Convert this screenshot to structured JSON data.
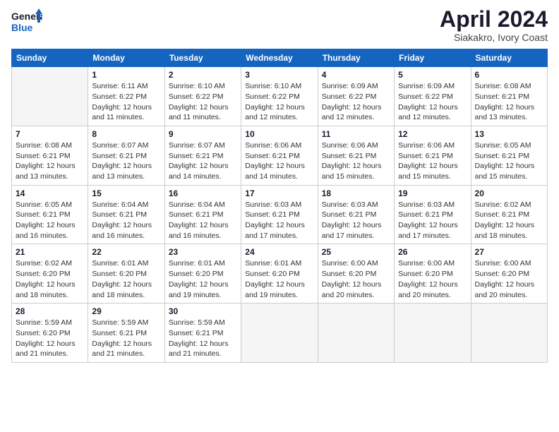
{
  "logo": {
    "line1": "General",
    "line2": "Blue"
  },
  "header": {
    "title": "April 2024",
    "location": "Siakakro, Ivory Coast"
  },
  "days_of_week": [
    "Sunday",
    "Monday",
    "Tuesday",
    "Wednesday",
    "Thursday",
    "Friday",
    "Saturday"
  ],
  "weeks": [
    [
      {
        "num": "",
        "sunrise": "",
        "sunset": "",
        "daylight": "",
        "empty": true
      },
      {
        "num": "1",
        "sunrise": "6:11 AM",
        "sunset": "6:22 PM",
        "daylight": "12 hours and 11 minutes."
      },
      {
        "num": "2",
        "sunrise": "6:10 AM",
        "sunset": "6:22 PM",
        "daylight": "12 hours and 11 minutes."
      },
      {
        "num": "3",
        "sunrise": "6:10 AM",
        "sunset": "6:22 PM",
        "daylight": "12 hours and 12 minutes."
      },
      {
        "num": "4",
        "sunrise": "6:09 AM",
        "sunset": "6:22 PM",
        "daylight": "12 hours and 12 minutes."
      },
      {
        "num": "5",
        "sunrise": "6:09 AM",
        "sunset": "6:22 PM",
        "daylight": "12 hours and 12 minutes."
      },
      {
        "num": "6",
        "sunrise": "6:08 AM",
        "sunset": "6:21 PM",
        "daylight": "12 hours and 13 minutes."
      }
    ],
    [
      {
        "num": "7",
        "sunrise": "6:08 AM",
        "sunset": "6:21 PM",
        "daylight": "12 hours and 13 minutes."
      },
      {
        "num": "8",
        "sunrise": "6:07 AM",
        "sunset": "6:21 PM",
        "daylight": "12 hours and 13 minutes."
      },
      {
        "num": "9",
        "sunrise": "6:07 AM",
        "sunset": "6:21 PM",
        "daylight": "12 hours and 14 minutes."
      },
      {
        "num": "10",
        "sunrise": "6:06 AM",
        "sunset": "6:21 PM",
        "daylight": "12 hours and 14 minutes."
      },
      {
        "num": "11",
        "sunrise": "6:06 AM",
        "sunset": "6:21 PM",
        "daylight": "12 hours and 15 minutes."
      },
      {
        "num": "12",
        "sunrise": "6:06 AM",
        "sunset": "6:21 PM",
        "daylight": "12 hours and 15 minutes."
      },
      {
        "num": "13",
        "sunrise": "6:05 AM",
        "sunset": "6:21 PM",
        "daylight": "12 hours and 15 minutes."
      }
    ],
    [
      {
        "num": "14",
        "sunrise": "6:05 AM",
        "sunset": "6:21 PM",
        "daylight": "12 hours and 16 minutes."
      },
      {
        "num": "15",
        "sunrise": "6:04 AM",
        "sunset": "6:21 PM",
        "daylight": "12 hours and 16 minutes."
      },
      {
        "num": "16",
        "sunrise": "6:04 AM",
        "sunset": "6:21 PM",
        "daylight": "12 hours and 16 minutes."
      },
      {
        "num": "17",
        "sunrise": "6:03 AM",
        "sunset": "6:21 PM",
        "daylight": "12 hours and 17 minutes."
      },
      {
        "num": "18",
        "sunrise": "6:03 AM",
        "sunset": "6:21 PM",
        "daylight": "12 hours and 17 minutes."
      },
      {
        "num": "19",
        "sunrise": "6:03 AM",
        "sunset": "6:21 PM",
        "daylight": "12 hours and 17 minutes."
      },
      {
        "num": "20",
        "sunrise": "6:02 AM",
        "sunset": "6:21 PM",
        "daylight": "12 hours and 18 minutes."
      }
    ],
    [
      {
        "num": "21",
        "sunrise": "6:02 AM",
        "sunset": "6:20 PM",
        "daylight": "12 hours and 18 minutes."
      },
      {
        "num": "22",
        "sunrise": "6:01 AM",
        "sunset": "6:20 PM",
        "daylight": "12 hours and 18 minutes."
      },
      {
        "num": "23",
        "sunrise": "6:01 AM",
        "sunset": "6:20 PM",
        "daylight": "12 hours and 19 minutes."
      },
      {
        "num": "24",
        "sunrise": "6:01 AM",
        "sunset": "6:20 PM",
        "daylight": "12 hours and 19 minutes."
      },
      {
        "num": "25",
        "sunrise": "6:00 AM",
        "sunset": "6:20 PM",
        "daylight": "12 hours and 20 minutes."
      },
      {
        "num": "26",
        "sunrise": "6:00 AM",
        "sunset": "6:20 PM",
        "daylight": "12 hours and 20 minutes."
      },
      {
        "num": "27",
        "sunrise": "6:00 AM",
        "sunset": "6:20 PM",
        "daylight": "12 hours and 20 minutes."
      }
    ],
    [
      {
        "num": "28",
        "sunrise": "5:59 AM",
        "sunset": "6:20 PM",
        "daylight": "12 hours and 21 minutes."
      },
      {
        "num": "29",
        "sunrise": "5:59 AM",
        "sunset": "6:21 PM",
        "daylight": "12 hours and 21 minutes."
      },
      {
        "num": "30",
        "sunrise": "5:59 AM",
        "sunset": "6:21 PM",
        "daylight": "12 hours and 21 minutes."
      },
      {
        "num": "",
        "sunrise": "",
        "sunset": "",
        "daylight": "",
        "empty": true
      },
      {
        "num": "",
        "sunrise": "",
        "sunset": "",
        "daylight": "",
        "empty": true
      },
      {
        "num": "",
        "sunrise": "",
        "sunset": "",
        "daylight": "",
        "empty": true
      },
      {
        "num": "",
        "sunrise": "",
        "sunset": "",
        "daylight": "",
        "empty": true
      }
    ]
  ],
  "labels": {
    "sunrise": "Sunrise:",
    "sunset": "Sunset:",
    "daylight": "Daylight:"
  }
}
